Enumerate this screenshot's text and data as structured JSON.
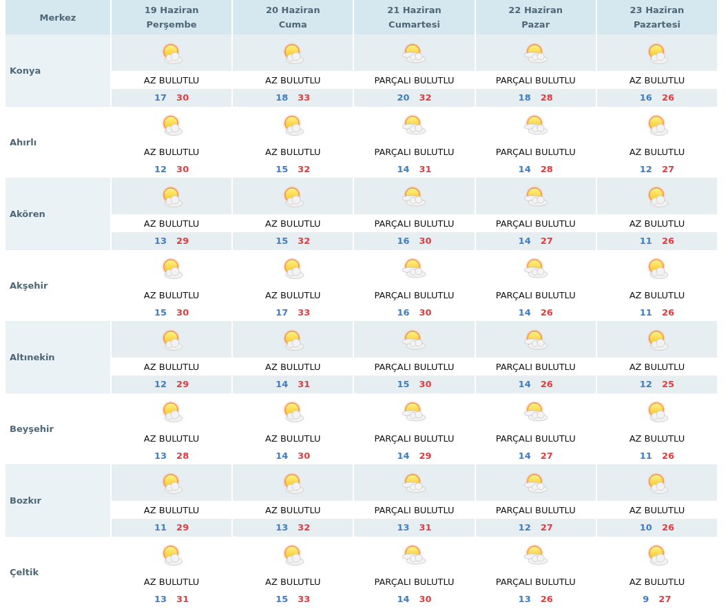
{
  "table": {
    "corner": "Merkez",
    "days": [
      {
        "date": "19 Haziran",
        "weekday": "Perşembe"
      },
      {
        "date": "20 Haziran",
        "weekday": "Cuma"
      },
      {
        "date": "21 Haziran",
        "weekday": "Cumartesi"
      },
      {
        "date": "22 Haziran",
        "weekday": "Pazar"
      },
      {
        "date": "23 Haziran",
        "weekday": "Pazartesi"
      }
    ],
    "rows": [
      {
        "city": "Konya",
        "forecasts": [
          {
            "kind": "few_clouds",
            "condition": "AZ BULUTLU",
            "low": "17",
            "high": "30"
          },
          {
            "kind": "few_clouds",
            "condition": "AZ BULUTLU",
            "low": "18",
            "high": "33"
          },
          {
            "kind": "partly_cloudy",
            "condition": "PARÇALI BULUTLU",
            "low": "20",
            "high": "32"
          },
          {
            "kind": "partly_cloudy",
            "condition": "PARÇALI BULUTLU",
            "low": "18",
            "high": "28"
          },
          {
            "kind": "few_clouds",
            "condition": "AZ BULUTLU",
            "low": "16",
            "high": "26"
          }
        ]
      },
      {
        "city": "Ahırlı",
        "forecasts": [
          {
            "kind": "few_clouds",
            "condition": "AZ BULUTLU",
            "low": "12",
            "high": "30"
          },
          {
            "kind": "few_clouds",
            "condition": "AZ BULUTLU",
            "low": "15",
            "high": "32"
          },
          {
            "kind": "partly_cloudy",
            "condition": "PARÇALI BULUTLU",
            "low": "14",
            "high": "31"
          },
          {
            "kind": "partly_cloudy",
            "condition": "PARÇALI BULUTLU",
            "low": "14",
            "high": "28"
          },
          {
            "kind": "few_clouds",
            "condition": "AZ BULUTLU",
            "low": "12",
            "high": "27"
          }
        ]
      },
      {
        "city": "Akören",
        "forecasts": [
          {
            "kind": "few_clouds",
            "condition": "AZ BULUTLU",
            "low": "13",
            "high": "29"
          },
          {
            "kind": "few_clouds",
            "condition": "AZ BULUTLU",
            "low": "15",
            "high": "32"
          },
          {
            "kind": "partly_cloudy",
            "condition": "PARÇALI BULUTLU",
            "low": "16",
            "high": "30"
          },
          {
            "kind": "partly_cloudy",
            "condition": "PARÇALI BULUTLU",
            "low": "14",
            "high": "27"
          },
          {
            "kind": "few_clouds",
            "condition": "AZ BULUTLU",
            "low": "11",
            "high": "26"
          }
        ]
      },
      {
        "city": "Akşehir",
        "forecasts": [
          {
            "kind": "few_clouds",
            "condition": "AZ BULUTLU",
            "low": "15",
            "high": "30"
          },
          {
            "kind": "few_clouds",
            "condition": "AZ BULUTLU",
            "low": "17",
            "high": "33"
          },
          {
            "kind": "partly_cloudy",
            "condition": "PARÇALI BULUTLU",
            "low": "16",
            "high": "30"
          },
          {
            "kind": "partly_cloudy",
            "condition": "PARÇALI BULUTLU",
            "low": "14",
            "high": "26"
          },
          {
            "kind": "few_clouds",
            "condition": "AZ BULUTLU",
            "low": "11",
            "high": "26"
          }
        ]
      },
      {
        "city": "Altınekin",
        "forecasts": [
          {
            "kind": "few_clouds",
            "condition": "AZ BULUTLU",
            "low": "12",
            "high": "29"
          },
          {
            "kind": "few_clouds",
            "condition": "AZ BULUTLU",
            "low": "14",
            "high": "31"
          },
          {
            "kind": "partly_cloudy",
            "condition": "PARÇALI BULUTLU",
            "low": "15",
            "high": "30"
          },
          {
            "kind": "partly_cloudy",
            "condition": "PARÇALI BULUTLU",
            "low": "14",
            "high": "26"
          },
          {
            "kind": "few_clouds",
            "condition": "AZ BULUTLU",
            "low": "12",
            "high": "25"
          }
        ]
      },
      {
        "city": "Beyşehir",
        "forecasts": [
          {
            "kind": "few_clouds",
            "condition": "AZ BULUTLU",
            "low": "13",
            "high": "28"
          },
          {
            "kind": "few_clouds",
            "condition": "AZ BULUTLU",
            "low": "14",
            "high": "30"
          },
          {
            "kind": "partly_cloudy",
            "condition": "PARÇALI BULUTLU",
            "low": "14",
            "high": "29"
          },
          {
            "kind": "partly_cloudy",
            "condition": "PARÇALI BULUTLU",
            "low": "14",
            "high": "27"
          },
          {
            "kind": "few_clouds",
            "condition": "AZ BULUTLU",
            "low": "11",
            "high": "26"
          }
        ]
      },
      {
        "city": "Bozkır",
        "forecasts": [
          {
            "kind": "few_clouds",
            "condition": "AZ BULUTLU",
            "low": "11",
            "high": "29"
          },
          {
            "kind": "few_clouds",
            "condition": "AZ BULUTLU",
            "low": "13",
            "high": "32"
          },
          {
            "kind": "partly_cloudy",
            "condition": "PARÇALI BULUTLU",
            "low": "13",
            "high": "31"
          },
          {
            "kind": "partly_cloudy",
            "condition": "PARÇALI BULUTLU",
            "low": "12",
            "high": "27"
          },
          {
            "kind": "few_clouds",
            "condition": "AZ BULUTLU",
            "low": "10",
            "high": "26"
          }
        ]
      },
      {
        "city": "Çeltik",
        "forecasts": [
          {
            "kind": "few_clouds",
            "condition": "AZ BULUTLU",
            "low": "13",
            "high": "31"
          },
          {
            "kind": "few_clouds",
            "condition": "AZ BULUTLU",
            "low": "15",
            "high": "33"
          },
          {
            "kind": "partly_cloudy",
            "condition": "PARÇALI BULUTLU",
            "low": "14",
            "high": "30"
          },
          {
            "kind": "partly_cloudy",
            "condition": "PARÇALI BULUTLU",
            "low": "13",
            "high": "26"
          },
          {
            "kind": "few_clouds",
            "condition": "AZ BULUTLU",
            "low": "9",
            "high": "27"
          }
        ]
      }
    ]
  }
}
